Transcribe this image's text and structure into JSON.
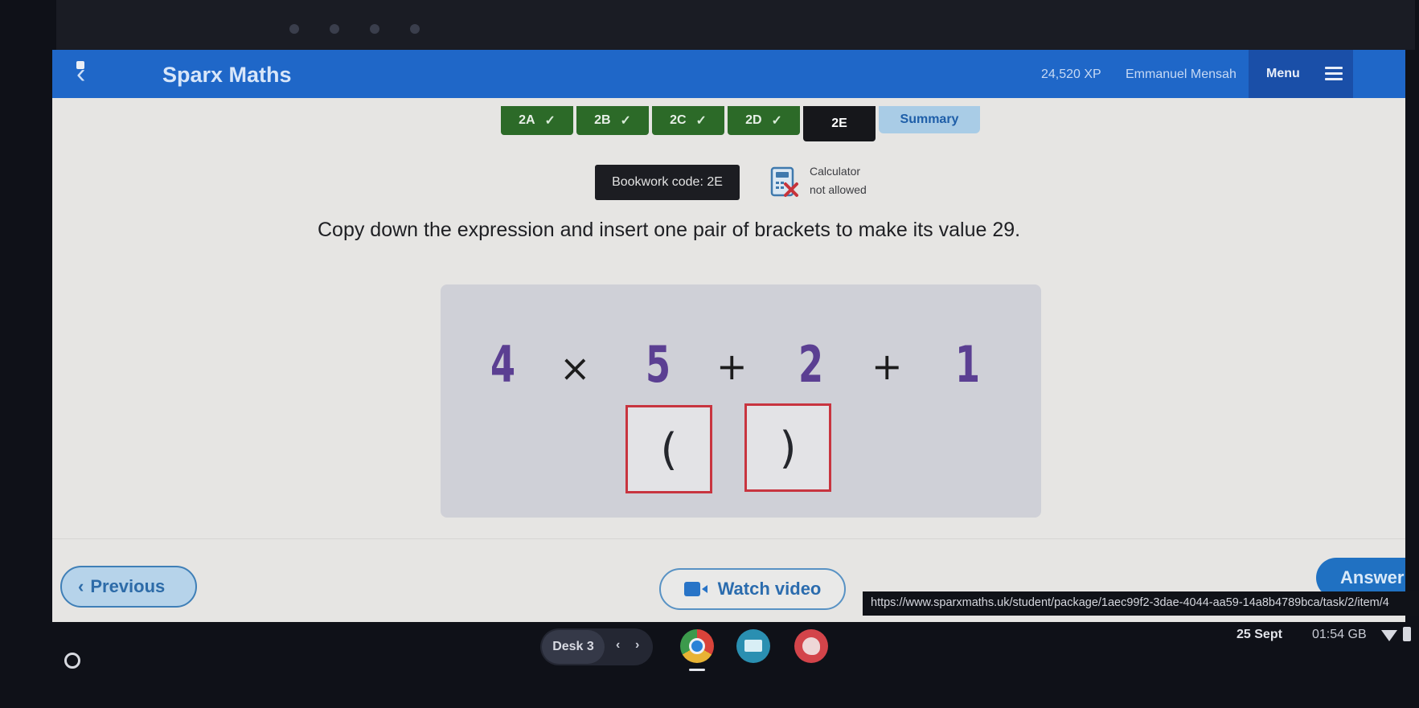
{
  "browser": {
    "bookmarks": [
      "",
      "",
      ""
    ]
  },
  "header": {
    "brand": "Sparx Maths",
    "xp": "24,520 XP",
    "user_name": "Emmanuel Mensah",
    "menu_label": "Menu"
  },
  "tabs": [
    {
      "label": "2A",
      "completed": true,
      "check": "✓"
    },
    {
      "label": "2B",
      "completed": true,
      "check": "✓"
    },
    {
      "label": "2C",
      "completed": true,
      "check": "✓"
    },
    {
      "label": "2D",
      "completed": true,
      "check": "✓"
    },
    {
      "label": "2E",
      "completed": false,
      "active": true
    },
    {
      "label": "Summary"
    }
  ],
  "bookwork": {
    "label": "Bookwork code: 2E"
  },
  "calculator": {
    "line1": "Calculator",
    "line2": "not allowed",
    "allowed": false
  },
  "question": {
    "text": "Copy down the expression and insert one pair of brackets to make its value 29.",
    "target_value": 29
  },
  "expression": {
    "tokens": [
      "4",
      "×",
      "5",
      "+",
      "2",
      "+",
      "1"
    ]
  },
  "brackets": {
    "open": "(",
    "close": ")"
  },
  "buttons": {
    "previous": "Previous",
    "previous_chevron": "‹",
    "watch_video": "Watch video",
    "answer": "Answer"
  },
  "status_bar": {
    "url": "https://www.sparxmaths.uk/student/package/1aec99f2-3dae-4044-aa59-14a8b4789bca/task/2/item/4"
  },
  "shelf": {
    "desk_label": "Desk 3",
    "desk_prev": "‹",
    "desk_next": "›",
    "apps": [
      "chrome",
      "cards",
      "canvas"
    ],
    "date": "25 Sept",
    "time": "01:54",
    "locale": "GB"
  },
  "colors": {
    "header_blue": "#1f67c8",
    "tab_done_green": "#2c6a28",
    "tab_active": "#16171b",
    "summary_bg": "#a9cce6",
    "number_purple": "#5b3f92",
    "bracket_border_red": "#c8343f",
    "answer_blue": "#2071c2"
  }
}
